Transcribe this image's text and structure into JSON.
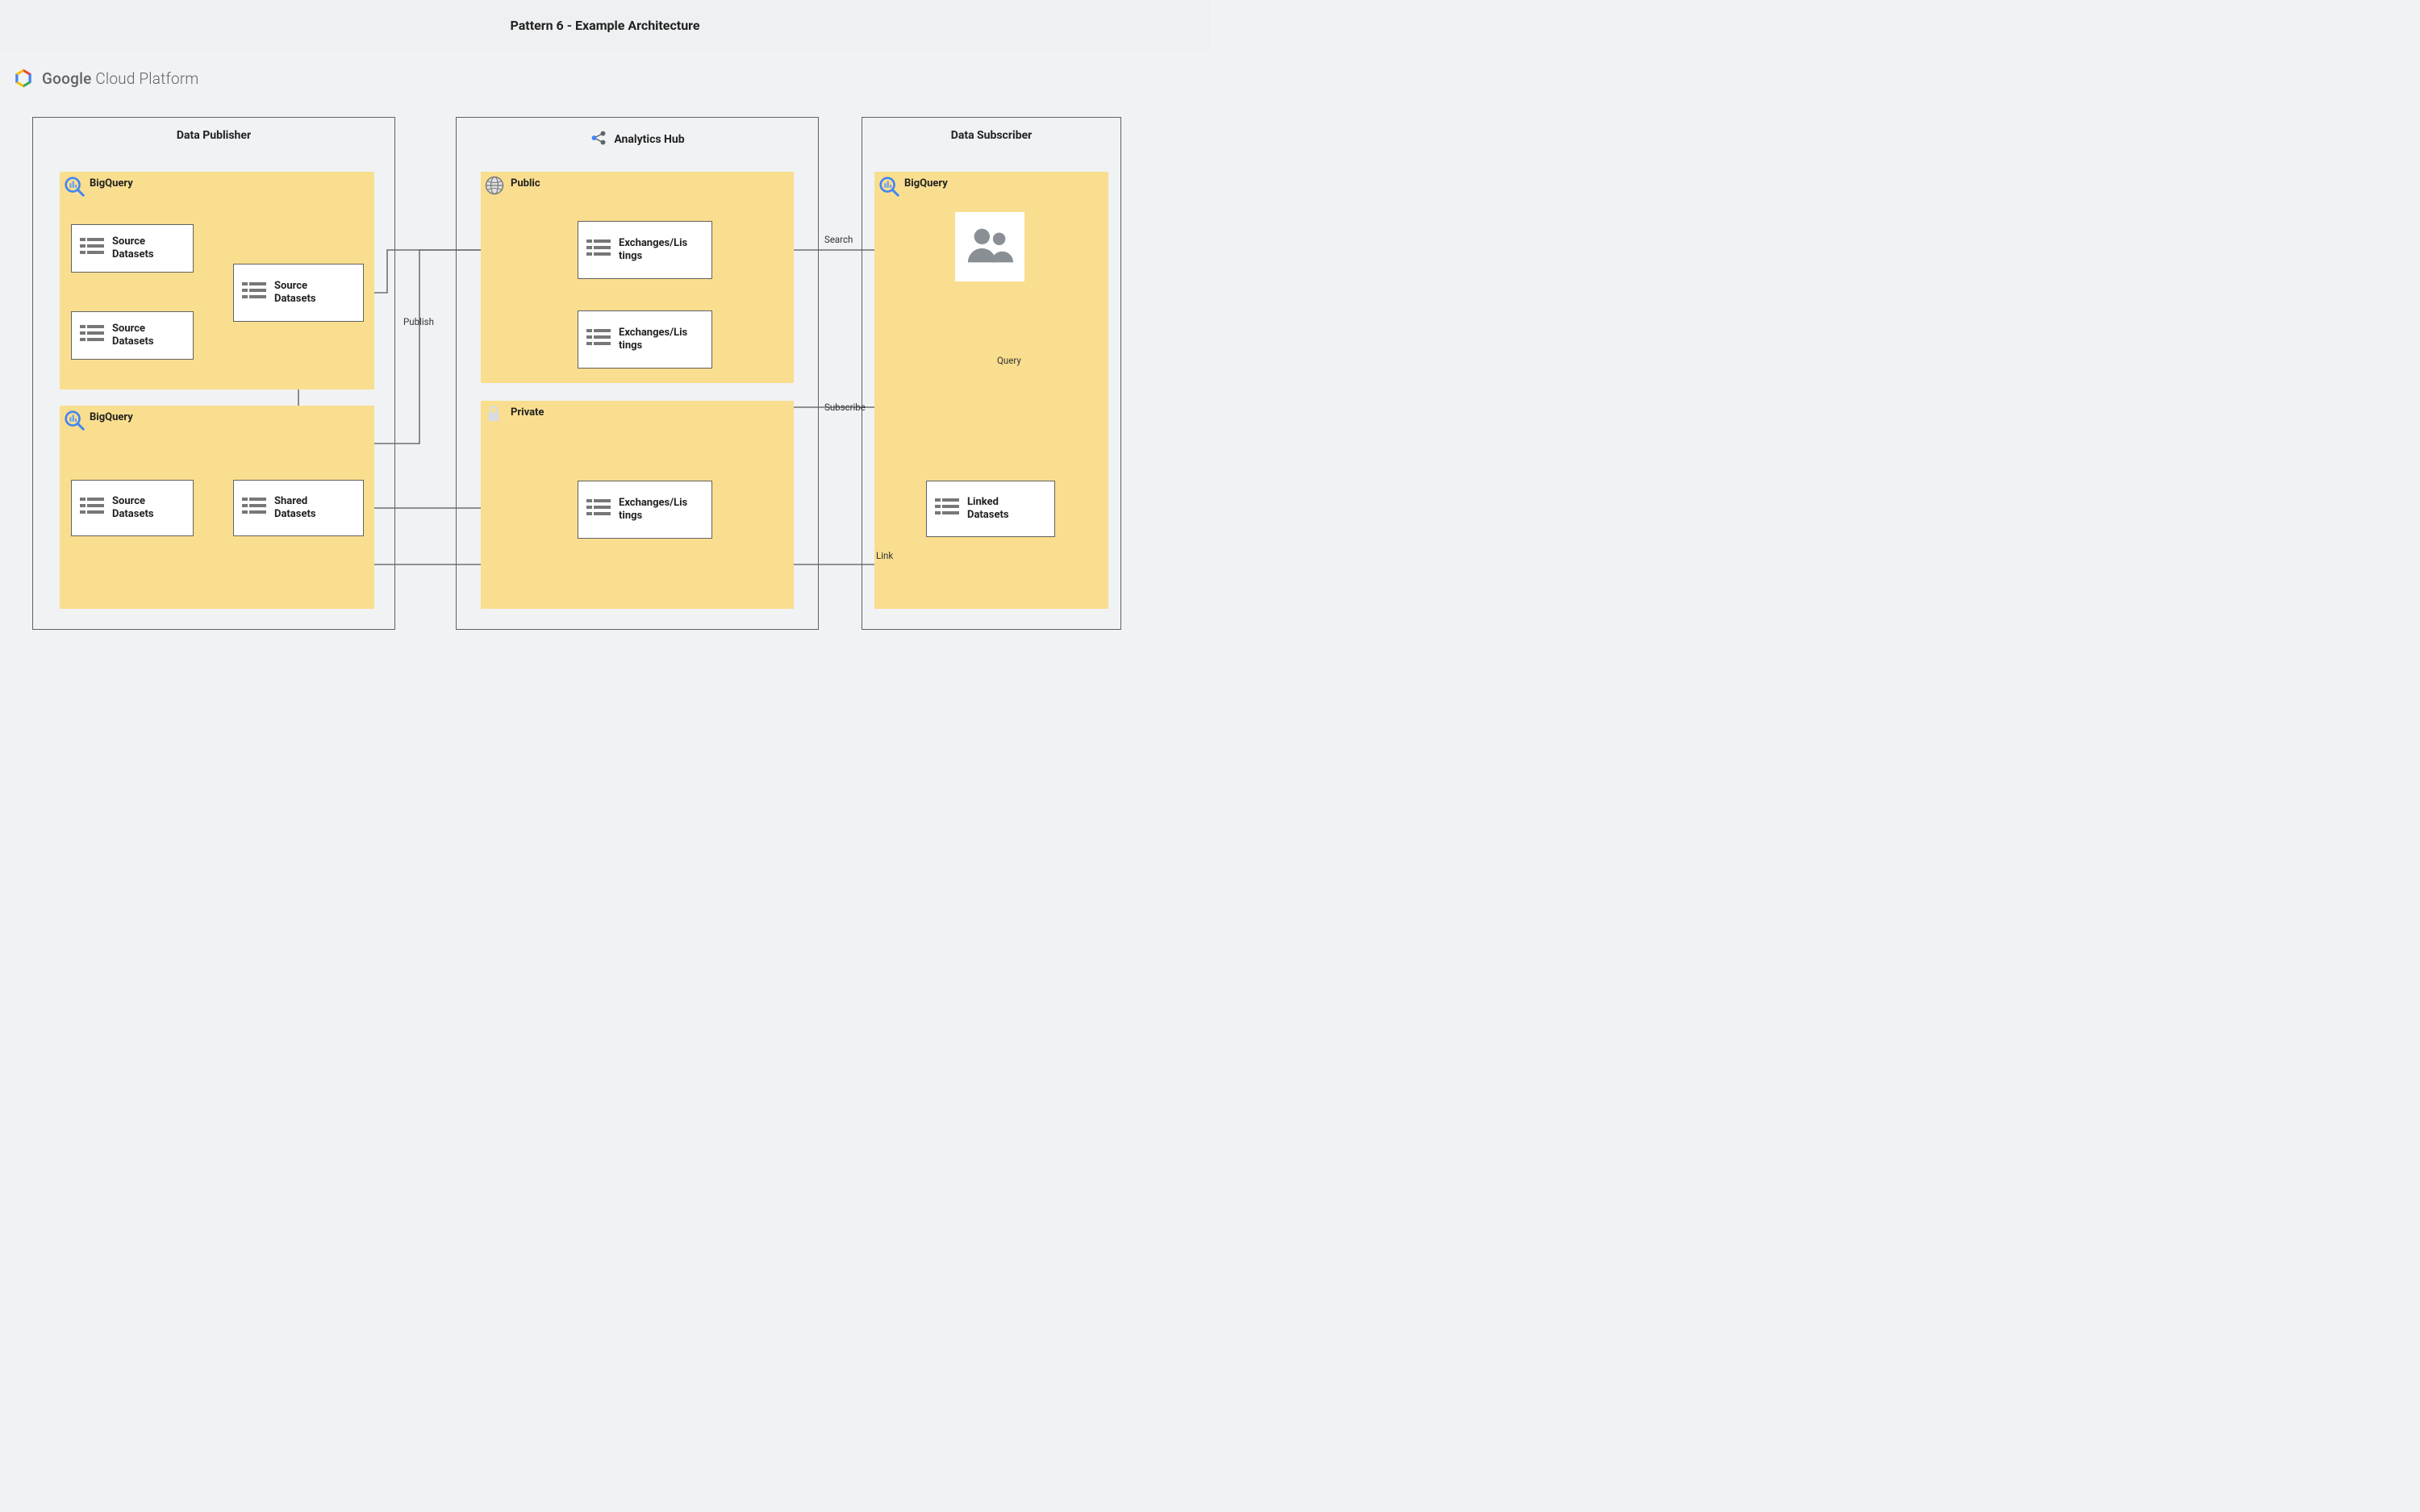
{
  "page_title": "Pattern 6 - Example Architecture",
  "header": {
    "brand_bold": "Google",
    "brand_rest": " Cloud Platform"
  },
  "groups": {
    "publisher": {
      "title": "Data Publisher"
    },
    "hub": {
      "title": "Analytics Hub"
    },
    "subscriber": {
      "title": "Data Subscriber"
    }
  },
  "subpanels": {
    "pub_bq1": {
      "label": "BigQuery",
      "icon": "bigquery"
    },
    "pub_bq2": {
      "label": "BigQuery",
      "icon": "bigquery"
    },
    "hub_public": {
      "label": "Public",
      "icon": "globe"
    },
    "hub_private": {
      "label": "Private",
      "icon": "lock"
    },
    "sub_bq": {
      "label": "BigQuery",
      "icon": "bigquery"
    }
  },
  "nodes": {
    "src1": "Source\nDatasets",
    "src2": "Source\nDatasets",
    "src3": "Source\nDatasets",
    "src4": "Source\nDatasets",
    "shared": "Shared\nDatasets",
    "exch1": "Exchanges/Lis\ntings",
    "exch2": "Exchanges/Lis\ntings",
    "exch3": "Exchanges/Lis\ntings",
    "linked": "Linked\nDatasets"
  },
  "labels": {
    "publish": "Publish",
    "search": "Search",
    "subscribe": "Subscribe",
    "link": "Link",
    "query": "Query"
  },
  "colors": {
    "panel_bg": "#f9de8f",
    "border": "#616161"
  }
}
